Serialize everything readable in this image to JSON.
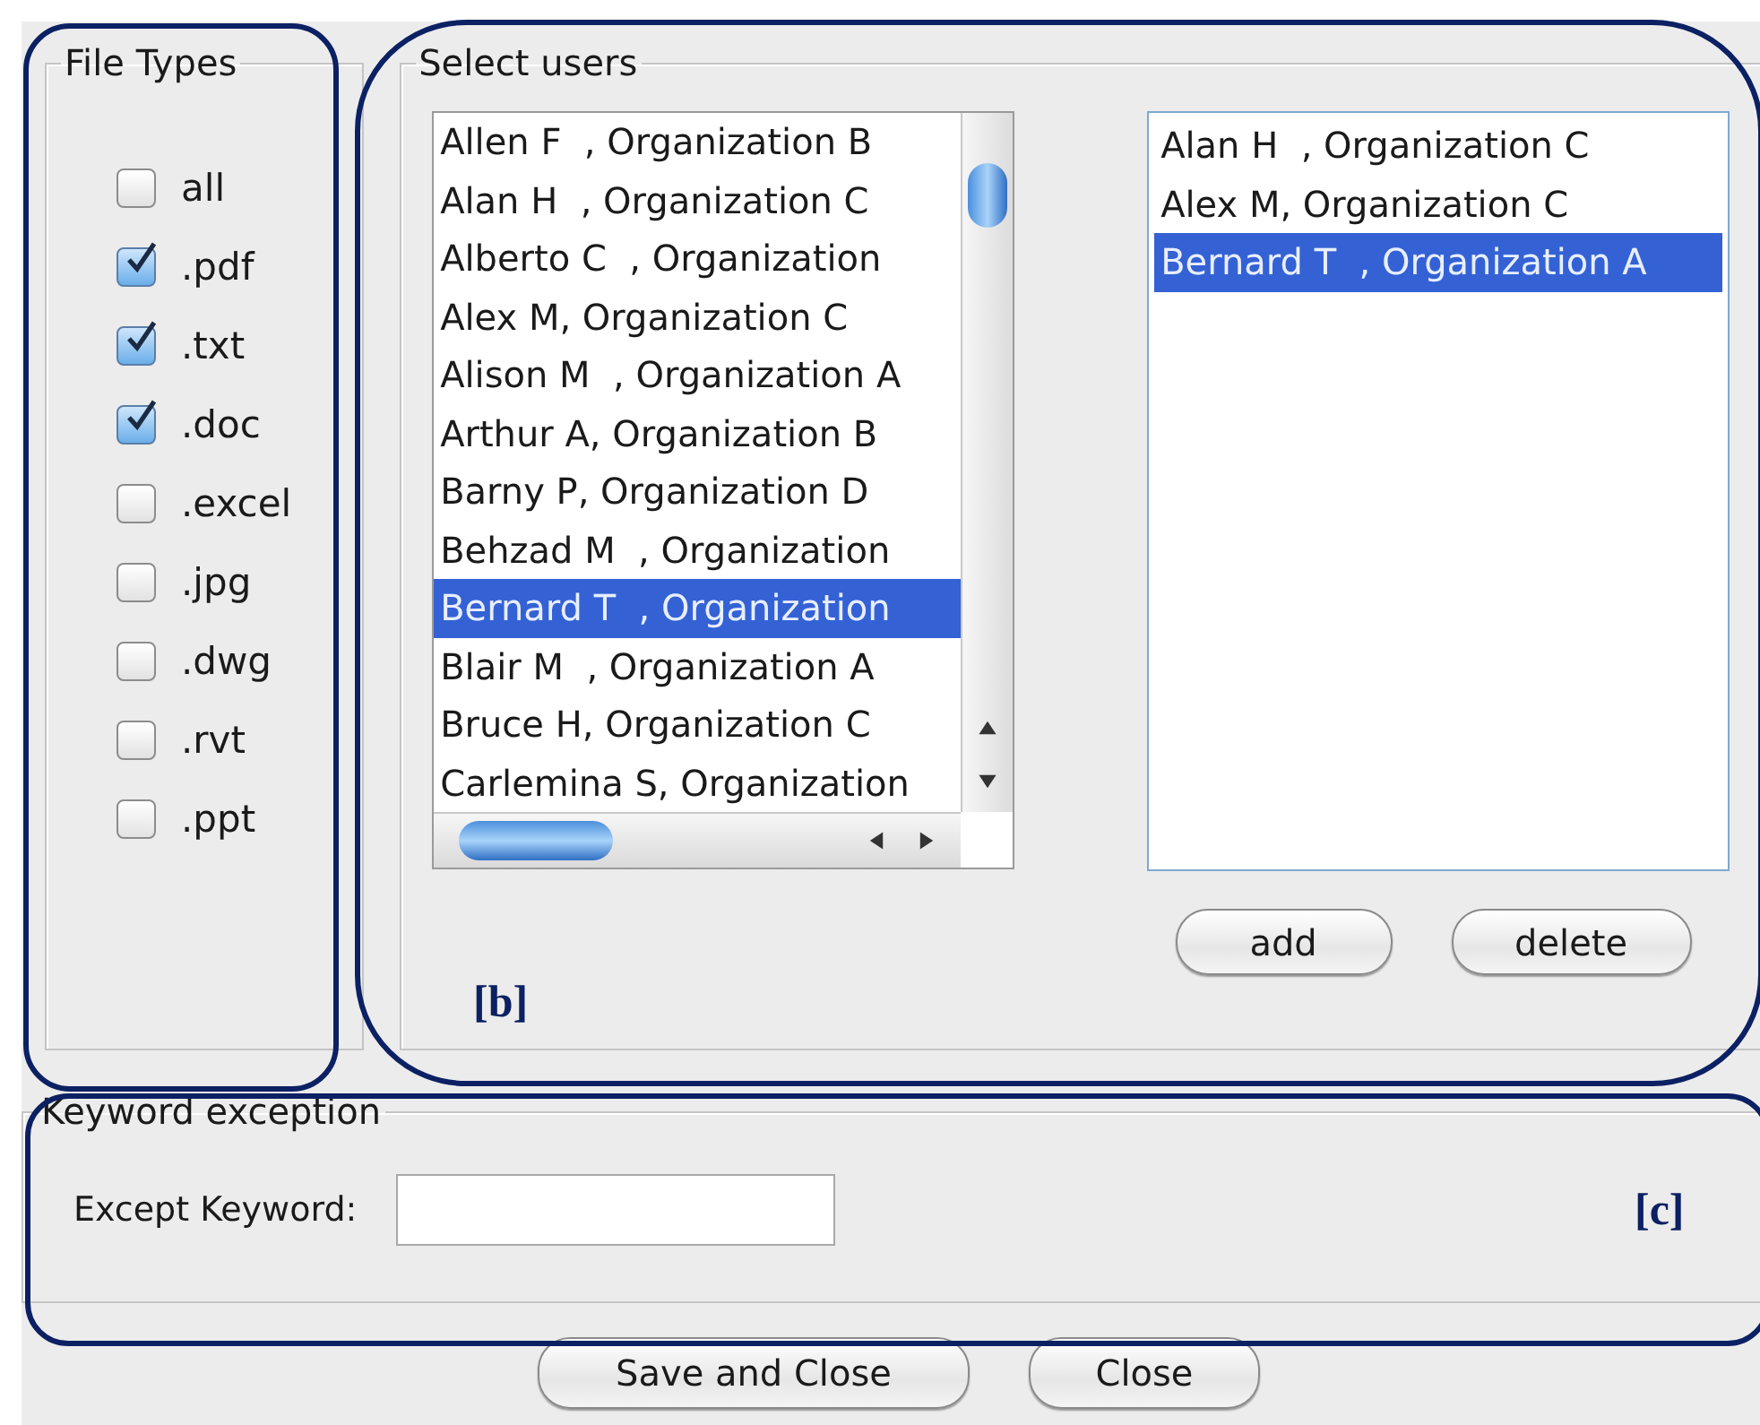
{
  "file_types": {
    "title": "File Types",
    "items": [
      {
        "label": "all",
        "checked": false
      },
      {
        "label": ".pdf",
        "checked": true
      },
      {
        "label": ".txt",
        "checked": true
      },
      {
        "label": ".doc",
        "checked": true
      },
      {
        "label": ".excel",
        "checked": false
      },
      {
        "label": ".jpg",
        "checked": false
      },
      {
        "label": ".dwg",
        "checked": false
      },
      {
        "label": ".rvt",
        "checked": false
      },
      {
        "label": ".ppt",
        "checked": false
      }
    ]
  },
  "select_users": {
    "title": "Select users",
    "available": [
      {
        "label": "Allen F  , Organization B",
        "selected": false
      },
      {
        "label": "Alan H  , Organization C",
        "selected": false
      },
      {
        "label": "Alberto C  , Organization",
        "selected": false
      },
      {
        "label": "Alex M, Organization C",
        "selected": false
      },
      {
        "label": "Alison M  , Organization A",
        "selected": false
      },
      {
        "label": "Arthur A, Organization B",
        "selected": false
      },
      {
        "label": "Barny P, Organization D",
        "selected": false
      },
      {
        "label": "Behzad M  , Organization",
        "selected": false
      },
      {
        "label": "Bernard T  , Organization",
        "selected": true
      },
      {
        "label": "Blair M  , Organization A",
        "selected": false
      },
      {
        "label": "Bruce H, Organization C",
        "selected": false
      },
      {
        "label": "Carlemina S, Organization",
        "selected": false
      }
    ],
    "chosen": [
      {
        "label": "Alan H  , Organization C",
        "selected": false
      },
      {
        "label": "Alex M, Organization C",
        "selected": false
      },
      {
        "label": "Bernard T  , Organization A",
        "selected": true
      }
    ],
    "buttons": [
      "add",
      "delete"
    ]
  },
  "keyword_exception": {
    "title": "Keyword exception",
    "field_label": "Except Keyword:"
  },
  "dialog_buttons": [
    "Save and Close",
    "Close"
  ],
  "annotations": [
    {
      "label": "[b]",
      "kind": "select"
    },
    {
      "label": "[c]",
      "kind": "keyword"
    },
    {
      "kind": "filetypes"
    }
  ]
}
